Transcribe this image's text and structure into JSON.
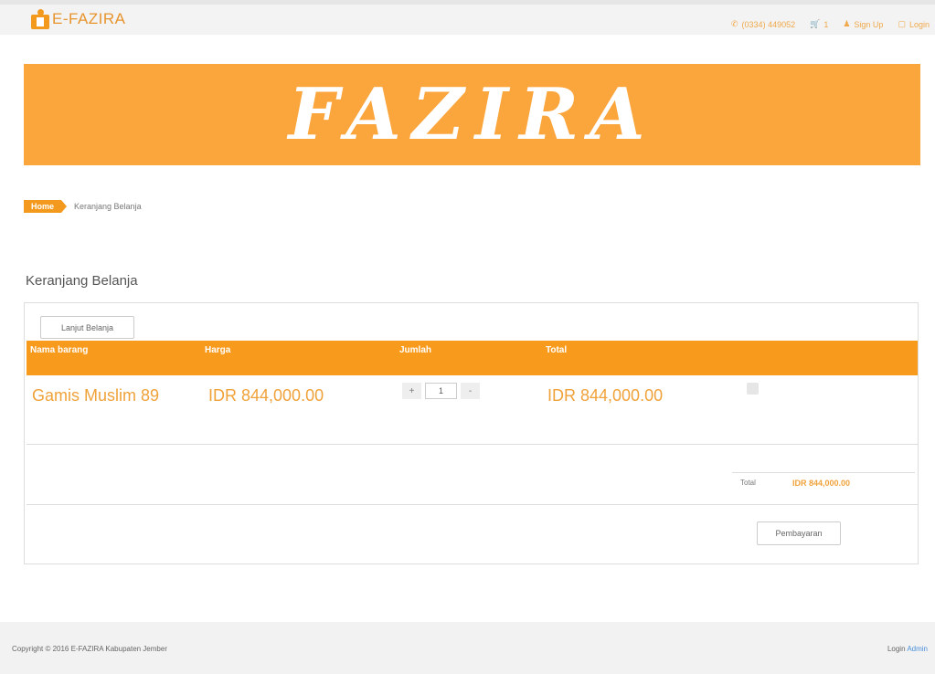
{
  "header": {
    "brand": "E-FAZIRA",
    "phone": "(0334) 449052",
    "cart_count": "1",
    "signup": "Sign Up",
    "login": "Login"
  },
  "banner": {
    "title": "FAZIRA"
  },
  "breadcrumb": {
    "home": "Home",
    "current": "Keranjang Belanja"
  },
  "page_title": "Keranjang Belanja",
  "cart": {
    "continue_label": "Lanjut Belanja",
    "columns": [
      "Nama barang",
      "Harga",
      "Jumlah",
      "Total"
    ],
    "items": [
      {
        "name": "Gamis Muslim 89",
        "price": "IDR 844,000.00",
        "qty": "1",
        "total": "IDR 844,000.00"
      }
    ],
    "qty_plus": "+",
    "qty_minus": "-",
    "total_label": "Total",
    "total_value": "IDR 844,000.00",
    "pay_label": "Pembayaran"
  },
  "footer": {
    "copyright": "Copyright © 2016 E-FAZIRA Kabupaten Jember",
    "login": "Login",
    "admin": "Admin"
  },
  "colors": {
    "accent": "#f89a1c",
    "banner": "#fba53d",
    "link": "#4a90d9"
  }
}
